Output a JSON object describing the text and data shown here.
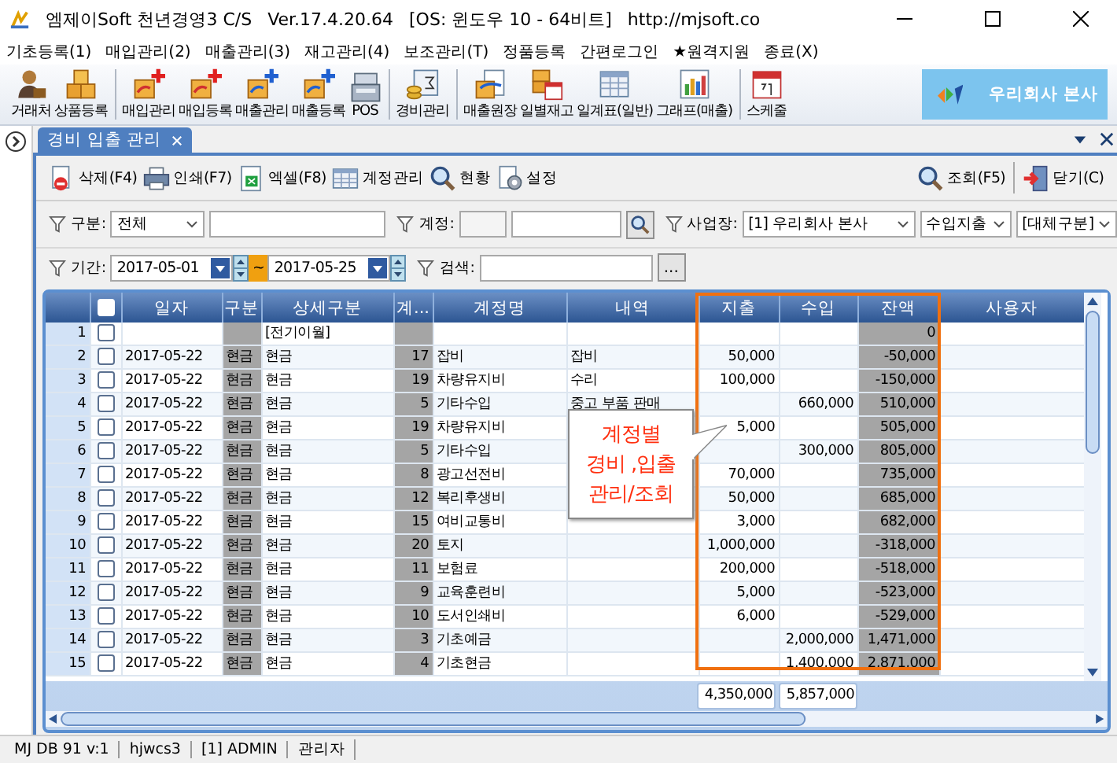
{
  "window": {
    "title": "엠제이Soft 천년경영3 C/S",
    "version": "Ver.17.4.20.64",
    "os": "[OS: 윈도우 10 - 64비트]",
    "url": "http://mjsoft.co"
  },
  "menu": [
    "기초등록(1)",
    "매입관리(2)",
    "매출관리(3)",
    "재고관리(4)",
    "보조관리(T)",
    "정품등록",
    "간편로그인",
    "★원격지원",
    "종료(X)"
  ],
  "toolbar": [
    "거래처",
    "상품등록",
    "매입관리",
    "매입등록",
    "매출관리",
    "매출등록",
    "POS",
    "경비관리",
    "매출원장",
    "일별재고",
    "일계표(일반)",
    "그래프(매출)",
    "스케줄"
  ],
  "company_button": "우리회사 본사",
  "tab": {
    "label": "경비 입출 관리",
    "selected": true
  },
  "actions_left": [
    "삭제(F4)",
    "인쇄(F7)",
    "엑셀(F8)",
    "계정관리",
    "현황",
    "설정"
  ],
  "actions_right": [
    "조회(F5)",
    "닫기(C)"
  ],
  "filters": {
    "division_label": "구분:",
    "division_value": "전체",
    "account_label": "계정:",
    "site_label": "사업장:",
    "site_value": "[1] 우리회사 본사",
    "flow_value": "수입지출",
    "transfer_value": "[대체구분]",
    "period_label": "기간:",
    "date_from": "2017-05-01",
    "tilde": "~",
    "date_to": "2017-05-25",
    "search_label": "검색:",
    "search_button": "..."
  },
  "table": {
    "header_checked": false,
    "columns": [
      "일자",
      "구분",
      "상세구분",
      "계...",
      "계정명",
      "내역",
      "지출",
      "수입",
      "잔액",
      "사용자"
    ],
    "rows": [
      {
        "no": "1",
        "checked": false,
        "detail": "[전기이월]",
        "balance": "0"
      },
      {
        "no": "2",
        "checked": false,
        "date": "2017-05-22",
        "type": "현금",
        "detail": "현금",
        "code": "17",
        "account": "잡비",
        "memo": "잡비",
        "out": "50,000",
        "balance": "-50,000"
      },
      {
        "no": "3",
        "checked": false,
        "date": "2017-05-22",
        "type": "현금",
        "detail": "현금",
        "code": "19",
        "account": "차량유지비",
        "memo": "수리",
        "out": "100,000",
        "balance": "-150,000"
      },
      {
        "no": "4",
        "checked": false,
        "date": "2017-05-22",
        "type": "현금",
        "detail": "현금",
        "code": "5",
        "account": "기타수입",
        "memo": "중고 부품 판매",
        "in": "660,000",
        "balance": "510,000"
      },
      {
        "no": "5",
        "checked": false,
        "date": "2017-05-22",
        "type": "현금",
        "detail": "현금",
        "code": "19",
        "account": "차량유지비",
        "out": "5,000",
        "balance": "505,000"
      },
      {
        "no": "6",
        "checked": false,
        "date": "2017-05-22",
        "type": "현금",
        "detail": "현금",
        "code": "5",
        "account": "기타수입",
        "in": "300,000",
        "balance": "805,000"
      },
      {
        "no": "7",
        "checked": false,
        "date": "2017-05-22",
        "type": "현금",
        "detail": "현금",
        "code": "8",
        "account": "광고선전비",
        "out": "70,000",
        "balance": "735,000"
      },
      {
        "no": "8",
        "checked": false,
        "date": "2017-05-22",
        "type": "현금",
        "detail": "현금",
        "code": "12",
        "account": "복리후생비",
        "out": "50,000",
        "balance": "685,000"
      },
      {
        "no": "9",
        "checked": false,
        "date": "2017-05-22",
        "type": "현금",
        "detail": "현금",
        "code": "15",
        "account": "여비교통비",
        "out": "3,000",
        "balance": "682,000"
      },
      {
        "no": "10",
        "checked": false,
        "date": "2017-05-22",
        "type": "현금",
        "detail": "현금",
        "code": "20",
        "account": "토지",
        "out": "1,000,000",
        "balance": "-318,000"
      },
      {
        "no": "11",
        "checked": false,
        "date": "2017-05-22",
        "type": "현금",
        "detail": "현금",
        "code": "11",
        "account": "보험료",
        "out": "200,000",
        "balance": "-518,000"
      },
      {
        "no": "12",
        "checked": false,
        "date": "2017-05-22",
        "type": "현금",
        "detail": "현금",
        "code": "9",
        "account": "교육훈련비",
        "out": "5,000",
        "balance": "-523,000"
      },
      {
        "no": "13",
        "checked": false,
        "date": "2017-05-22",
        "type": "현금",
        "detail": "현금",
        "code": "10",
        "account": "도서인쇄비",
        "out": "6,000",
        "balance": "-529,000"
      },
      {
        "no": "14",
        "checked": false,
        "date": "2017-05-22",
        "type": "현금",
        "detail": "현금",
        "code": "3",
        "account": "기초예금",
        "in": "2,000,000",
        "balance": "1,471,000"
      },
      {
        "no": "15",
        "checked": false,
        "date": "2017-05-22",
        "type": "현금",
        "detail": "현금",
        "code": "4",
        "account": "기초현금",
        "in": "1,400,000",
        "balance": "2,871,000"
      }
    ],
    "total_out": "4,350,000",
    "total_in": "5,857,000"
  },
  "callout": [
    "계정별",
    "경비 ,입출",
    "관리/조회"
  ],
  "status_bar": [
    "MJ DB 91 v:1",
    "hjwcs3",
    "[1] ADMIN",
    "관리자"
  ]
}
